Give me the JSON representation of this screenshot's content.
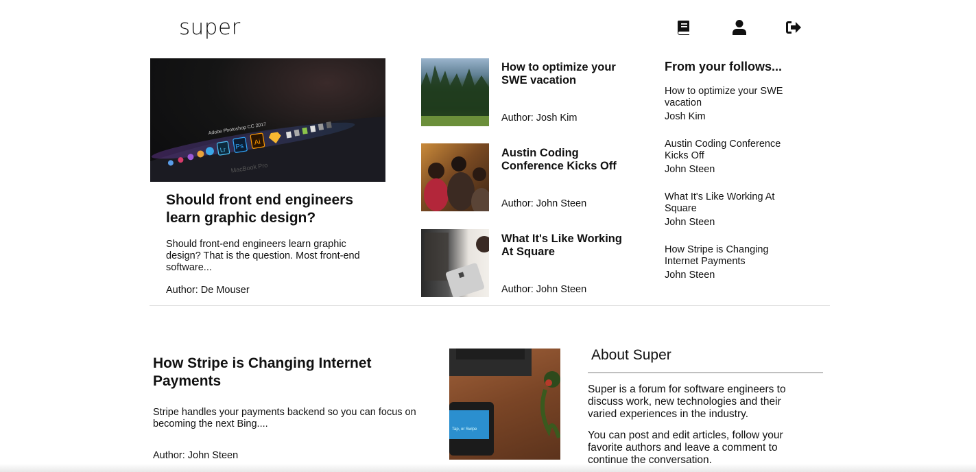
{
  "brand": {
    "logo_text": "super"
  },
  "nav": {
    "icons": [
      "book-icon",
      "user-icon",
      "sign-out-icon"
    ]
  },
  "featured": {
    "title": "Should front end engineers learn graphic design?",
    "excerpt": "Should front-end engineers learn graphic design? That is the question. Most front-end software...",
    "author": "Author: De Mouser"
  },
  "cards": [
    {
      "title": "How to optimize your SWE vacation",
      "author": "Author: Josh Kim"
    },
    {
      "title": "Austin Coding Conference Kicks Off",
      "author": "Author: John Steen"
    },
    {
      "title": "What It's Like Working At Square",
      "author": "Author: John Steen"
    }
  ],
  "follows": {
    "heading": "From your follows...",
    "items": [
      {
        "title": "How to optimize your SWE vacation",
        "author": "Josh Kim"
      },
      {
        "title": "Austin Coding Conference Kicks Off",
        "author": "John Steen"
      },
      {
        "title": "What It's Like Working At Square",
        "author": "John Steen"
      },
      {
        "title": "How Stripe is Changing Internet Payments",
        "author": "John Steen"
      }
    ]
  },
  "second_feature": {
    "title": "How Stripe is Changing Internet Payments",
    "excerpt": "Stripe handles your payments backend so you can focus on becoming the next Bing....",
    "author": "Author: John Steen"
  },
  "about": {
    "heading": "About Super",
    "p1": "Super is a forum for software engineers to discuss work, new technologies and their varied experiences in the industry.",
    "p2": "You can post and edit articles, follow your favorite authors and leave a comment to continue the conversation."
  },
  "image_text": {
    "ps_label": "Adobe Photoshop CC 2017",
    "macbook": "MacBook Pro",
    "tap": "Tap, or Swipe"
  }
}
